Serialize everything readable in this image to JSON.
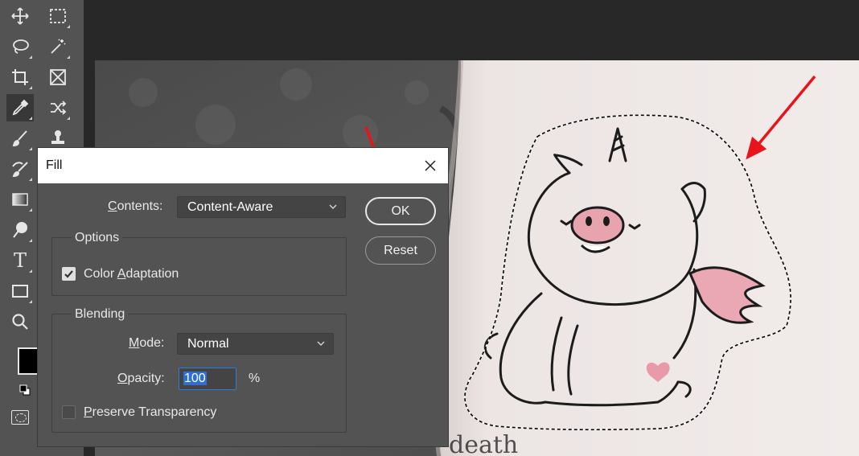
{
  "toolbar": {
    "tools": [
      {
        "name": "move-tool"
      },
      {
        "name": "marquee-tool"
      },
      {
        "name": "lasso-tool"
      },
      {
        "name": "magic-wand-tool"
      },
      {
        "name": "crop-tool"
      },
      {
        "name": "frame-tool"
      },
      {
        "name": "eyedropper-tool"
      },
      {
        "name": "patch-tool"
      },
      {
        "name": "brush-tool"
      },
      {
        "name": "clone-stamp-tool"
      },
      {
        "name": "history-brush-tool"
      },
      {
        "name": "gradient-tool"
      },
      {
        "name": "dodge-tool"
      },
      {
        "name": "type-tool"
      },
      {
        "name": "rectangle-tool"
      },
      {
        "name": "zoom-tool"
      }
    ],
    "type_glyph": "T",
    "foreground_color": "#000000"
  },
  "dialog": {
    "title": "Fill",
    "contents_label_first": "C",
    "contents_label_rest": "ontents:",
    "contents_value": "Content-Aware",
    "options_title": "Options",
    "color_adaptation_label_a": "Color ",
    "color_adaptation_label_u": "A",
    "color_adaptation_label_b": "daptation",
    "color_adaptation_checked": true,
    "blending_title": "Blending",
    "mode_label_u": "M",
    "mode_label_rest": "ode:",
    "mode_value": "Normal",
    "opacity_label_u": "O",
    "opacity_label_rest": "pacity:",
    "opacity_value": "100",
    "opacity_unit": "%",
    "preserve_label_u": "P",
    "preserve_label_rest": "reserve Transparency",
    "preserve_checked": false,
    "ok_label": "OK",
    "reset_label": "Reset"
  },
  "canvas": {
    "bottom_text": "death"
  },
  "colors": {
    "app_bg": "#282828",
    "panel": "#535353",
    "annotation_arrow": "#e8141a",
    "selection_focus": "#2f6fd1"
  }
}
